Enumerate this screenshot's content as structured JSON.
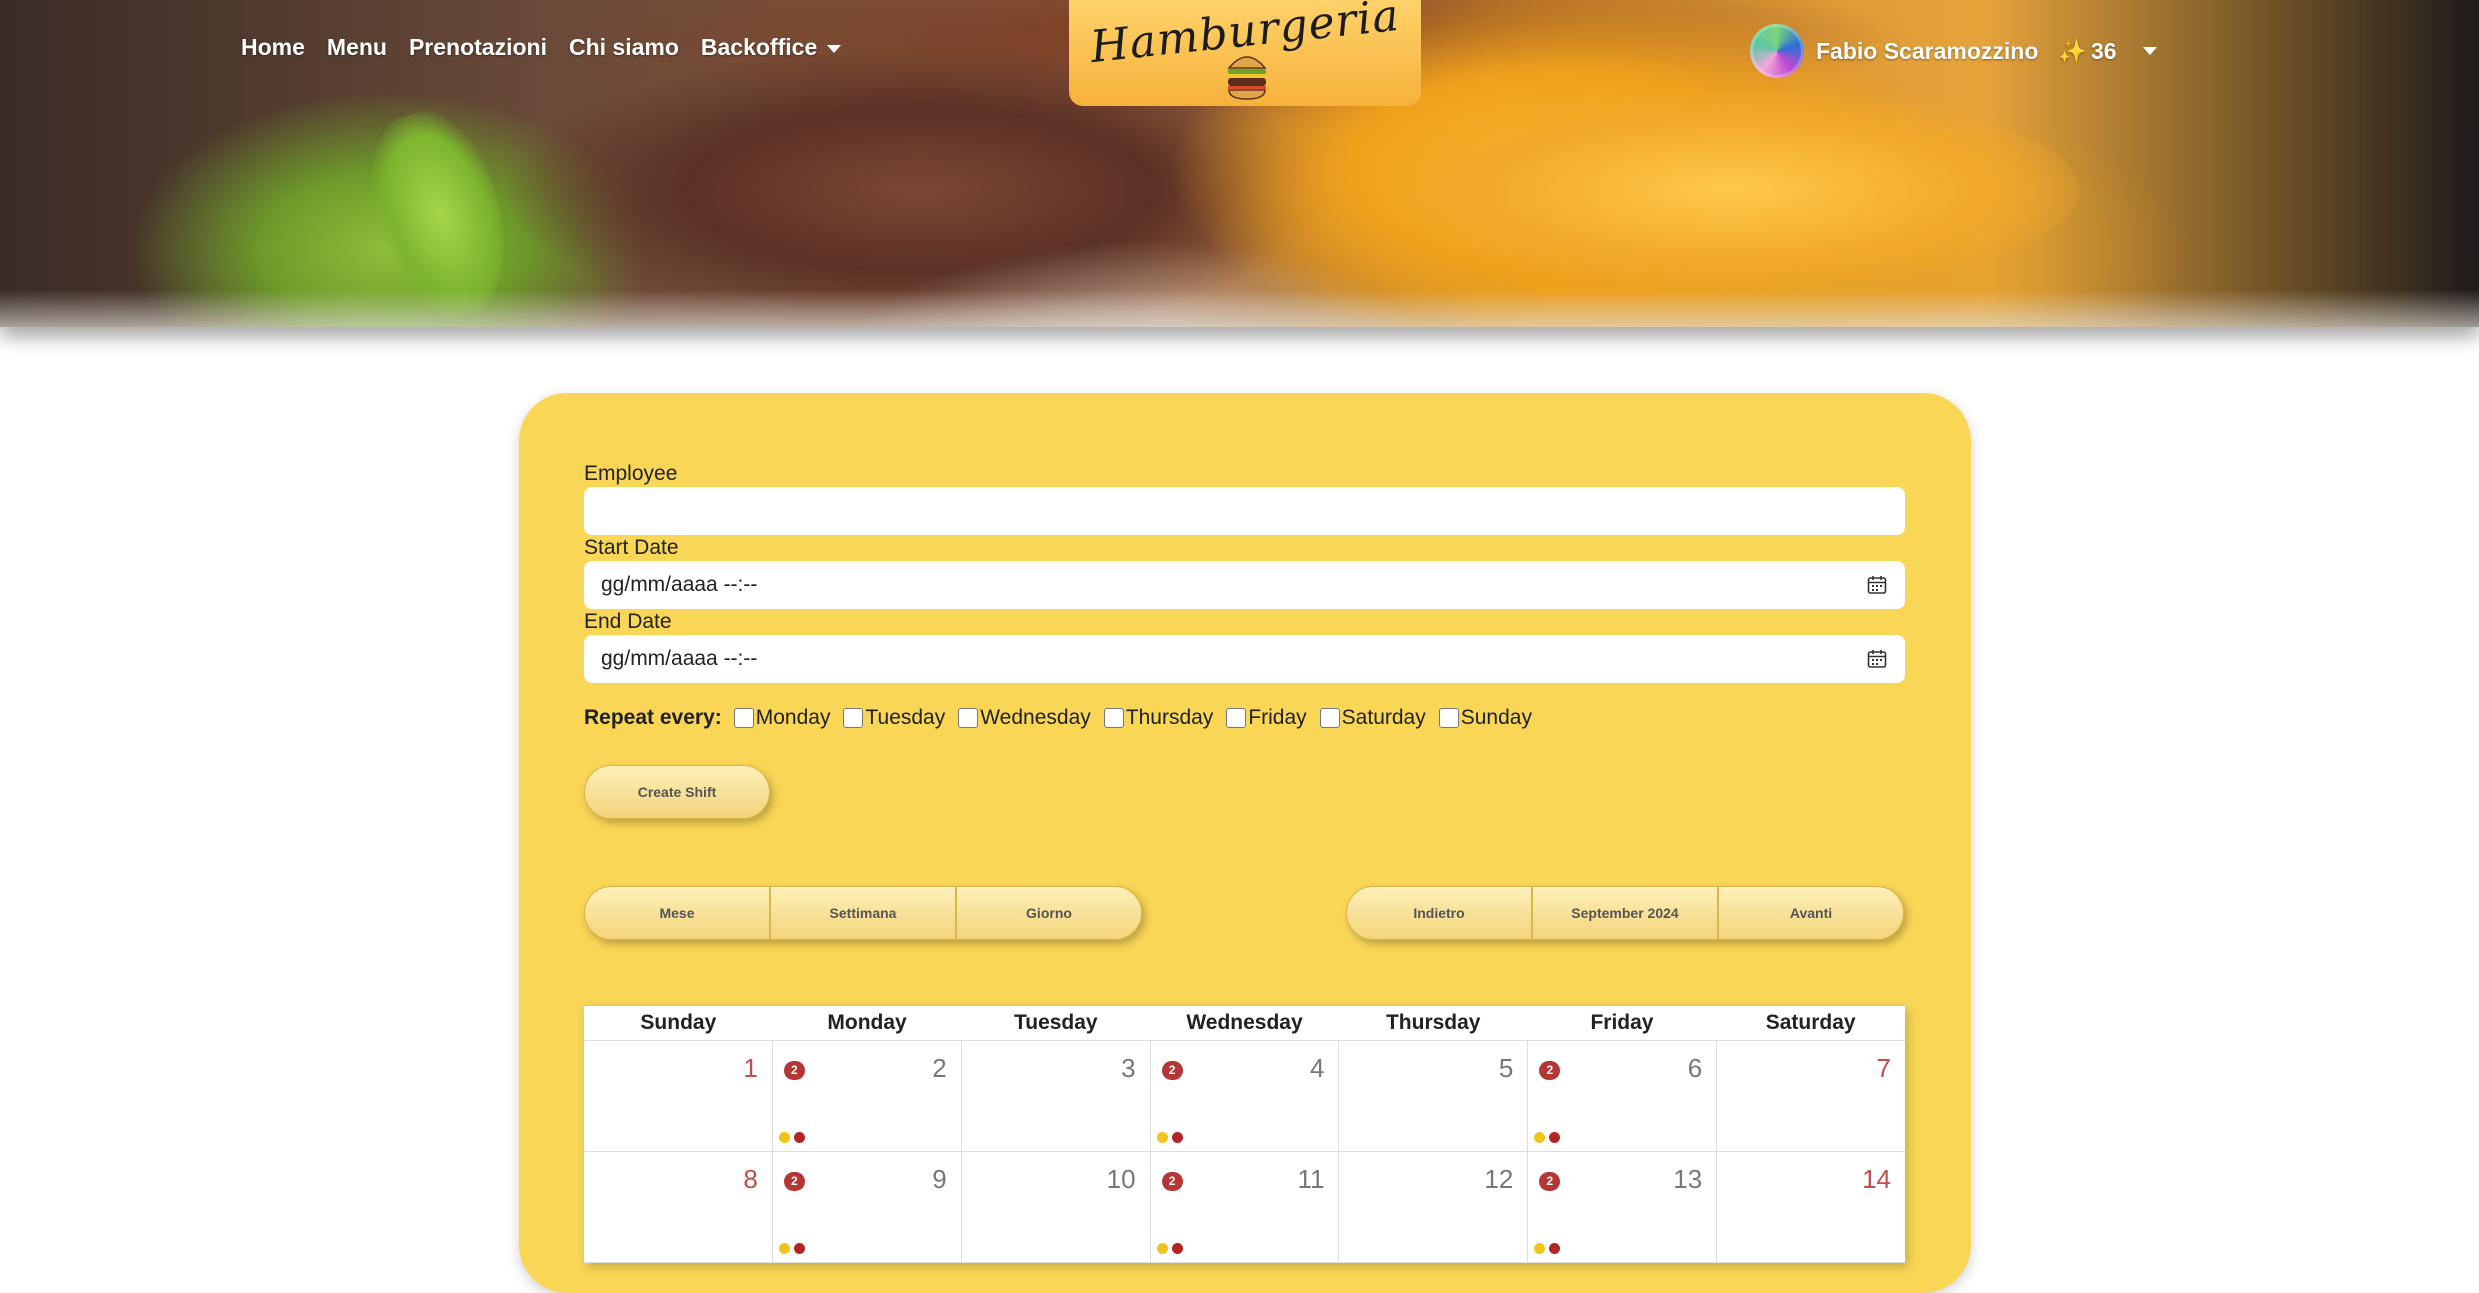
{
  "nav": {
    "links": [
      "Home",
      "Menu",
      "Prenotazioni",
      "Chi siamo",
      "Backoffice"
    ],
    "logo_text": "Hamburgeria",
    "user_name": "Fabio Scaramozzino",
    "points": "36",
    "points_icon": "✨"
  },
  "form": {
    "employee_label": "Employee",
    "employee_value": "",
    "start_label": "Start Date",
    "start_placeholder": "gg/mm/aaaa --:--",
    "end_label": "End Date",
    "end_placeholder": "gg/mm/aaaa --:--",
    "repeat_label": "Repeat every:",
    "days": [
      "Monday",
      "Tuesday",
      "Wednesday",
      "Thursday",
      "Friday",
      "Saturday",
      "Sunday"
    ],
    "create_label": "Create Shift"
  },
  "toolbar": {
    "views": [
      "Mese",
      "Settimana",
      "Giorno"
    ],
    "back_label": "Indietro",
    "current_label": "September 2024",
    "next_label": "Avanti"
  },
  "calendar": {
    "weekdays": [
      "Sunday",
      "Monday",
      "Tuesday",
      "Wednesday",
      "Thursday",
      "Friday",
      "Saturday"
    ],
    "weeks": [
      [
        {
          "day": "1",
          "weekend": true,
          "badge": null,
          "dots": false
        },
        {
          "day": "2",
          "weekend": false,
          "badge": "2",
          "dots": true
        },
        {
          "day": "3",
          "weekend": false,
          "badge": null,
          "dots": false
        },
        {
          "day": "4",
          "weekend": false,
          "badge": "2",
          "dots": true
        },
        {
          "day": "5",
          "weekend": false,
          "badge": null,
          "dots": false
        },
        {
          "day": "6",
          "weekend": false,
          "badge": "2",
          "dots": true
        },
        {
          "day": "7",
          "weekend": true,
          "badge": null,
          "dots": false
        }
      ],
      [
        {
          "day": "8",
          "weekend": true,
          "badge": null,
          "dots": false
        },
        {
          "day": "9",
          "weekend": false,
          "badge": "2",
          "dots": true
        },
        {
          "day": "10",
          "weekend": false,
          "badge": null,
          "dots": false
        },
        {
          "day": "11",
          "weekend": false,
          "badge": "2",
          "dots": true
        },
        {
          "day": "12",
          "weekend": false,
          "badge": null,
          "dots": false
        },
        {
          "day": "13",
          "weekend": false,
          "badge": "2",
          "dots": true
        },
        {
          "day": "14",
          "weekend": true,
          "badge": null,
          "dots": false
        }
      ]
    ]
  },
  "colors": {
    "card_bg": "#f9d656",
    "logo_bg": "#f7b13b",
    "badge": "#b63535",
    "dot_yellow": "#f0c419",
    "dot_red": "#b52424",
    "weekend_text": "#c24d4d"
  }
}
